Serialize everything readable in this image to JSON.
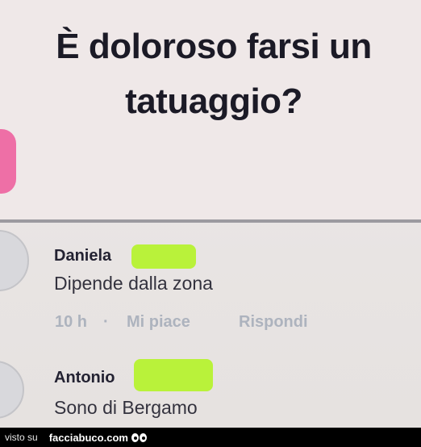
{
  "post": {
    "question": "È doloroso farsi un tatuaggio?"
  },
  "comments": [
    {
      "author": "Daniela",
      "text": "Dipende dalla zona",
      "time": "10 h",
      "separator": "·",
      "like_label": "Mi piace",
      "reply_label": "Rispondi"
    },
    {
      "author": "Antonio",
      "text": "Sono di Bergamo"
    }
  ],
  "watermark": {
    "prefix": "visto su",
    "site": "facciabuco.com"
  },
  "colors": {
    "censor_highlight": "#b9f23a",
    "sticker_pink": "#ee6fa6",
    "meta_gray": "#adb3be"
  }
}
